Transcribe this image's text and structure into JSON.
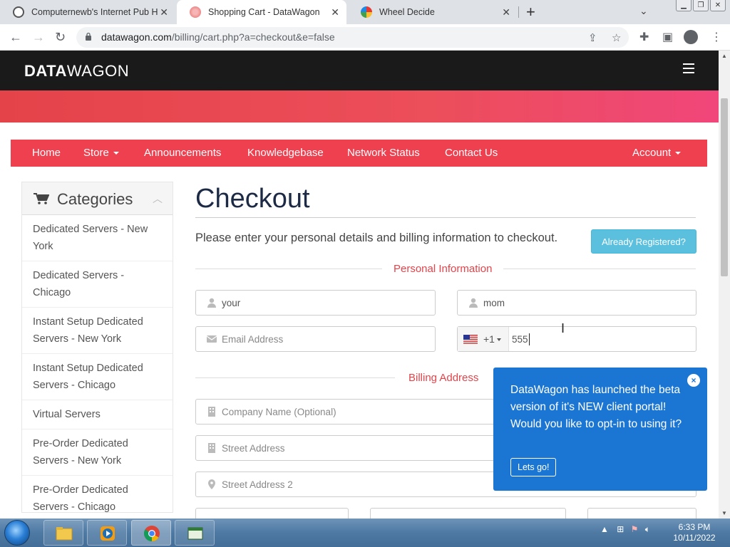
{
  "browser": {
    "tabs": [
      {
        "title": "Computernewb's Internet Pub Hä",
        "active": false
      },
      {
        "title": "Shopping Cart - DataWagon",
        "active": true
      },
      {
        "title": "Wheel Decide",
        "active": false
      }
    ],
    "url_domain": "datawagon.com",
    "url_path": "/billing/cart.php?a=checkout&e=false"
  },
  "site": {
    "logo_bold": "DATA",
    "logo_light": "WAGON",
    "nav": {
      "home": "Home",
      "store": "Store",
      "announcements": "Announcements",
      "knowledgebase": "Knowledgebase",
      "network_status": "Network Status",
      "contact": "Contact Us",
      "account": "Account"
    },
    "accent_color": "#ef4050"
  },
  "sidebar": {
    "title": "Categories",
    "items": [
      {
        "label": "Dedicated Servers - New York"
      },
      {
        "label": "Dedicated Servers - Chicago"
      },
      {
        "label": "Instant Setup Dedicated Servers - New York"
      },
      {
        "label": "Instant Setup Dedicated Servers - Chicago"
      },
      {
        "label": "Virtual Servers"
      },
      {
        "label": "Pre-Order Dedicated Servers - New York"
      },
      {
        "label": "Pre-Order Dedicated Servers - Chicago"
      }
    ]
  },
  "checkout": {
    "title": "Checkout",
    "intro": "Please enter your personal details and billing information to checkout.",
    "already_registered": "Already Registered?",
    "personal_section": "Personal Information",
    "billing_section": "Billing Address",
    "first_name": "your",
    "last_name": "mom",
    "email_placeholder": "Email Address",
    "phone_code": "+1",
    "phone_value": "555",
    "company_placeholder": "Company Name (Optional)",
    "street_placeholder": "Street Address",
    "street2_placeholder": "Street Address 2"
  },
  "popup": {
    "message": "DataWagon has launched the beta version of it's NEW client portal! Would you like to opt-in to using it?",
    "button": "Lets go!",
    "close": "×"
  },
  "taskbar": {
    "time": "6:33 PM",
    "date": "10/11/2022"
  }
}
